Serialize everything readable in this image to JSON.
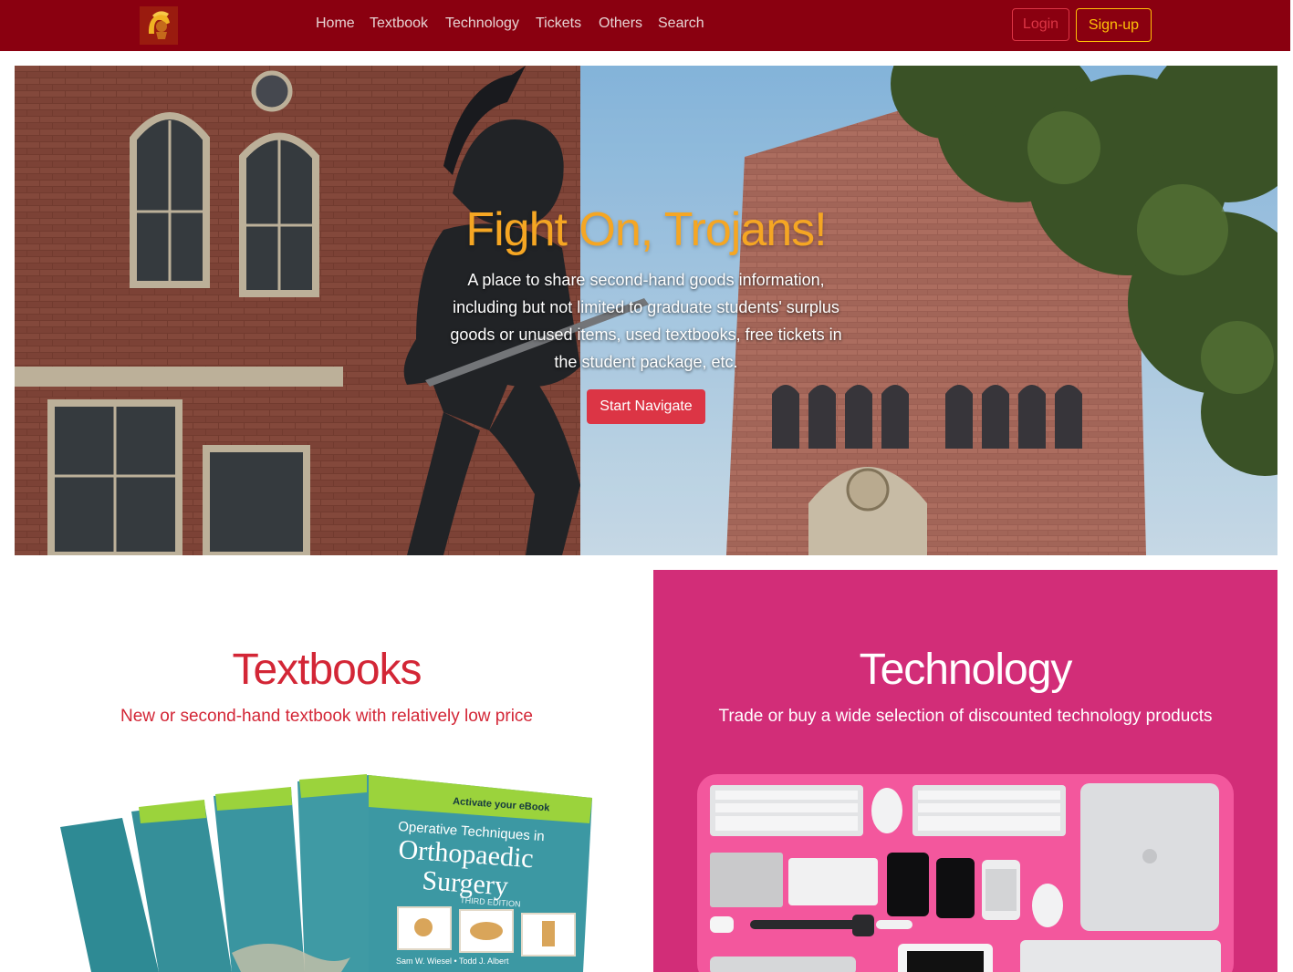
{
  "nav": {
    "logo_alt": "USC Trojan logo",
    "links": [
      "Home",
      "Textbook",
      "Technology",
      "Tickets",
      "Others",
      "Search"
    ],
    "login_label": "Login",
    "signup_label": "Sign-up"
  },
  "hero": {
    "title": "Fight On, Trojans!",
    "description": "A place to share second-hand goods information, including but not limited to graduate students' surplus goods or unused items, used textbooks, free tickets in the student package, etc.",
    "button_label": "Start Navigate"
  },
  "sections": [
    {
      "title": "Textbooks",
      "subtitle": "New or second-hand textbook with relatively low price",
      "image_text": {
        "banner": "Activate your eBook",
        "book_title_1": "Operative Techniques in",
        "book_title_2": "Orthopaedic",
        "book_title_3": "Surgery",
        "edition": "THIRD EDITION",
        "authors": "Sam W. Wiesel • Todd J. Albert"
      }
    },
    {
      "title": "Technology",
      "subtitle": "Trade or buy a wide selection of discounted technology products"
    }
  ],
  "colors": {
    "navbar": "#8a0010",
    "accent_red": "#dc3545",
    "accent_gold": "#ffc107",
    "hero_title": "#f5a623",
    "tech_bg": "#d22d78"
  }
}
